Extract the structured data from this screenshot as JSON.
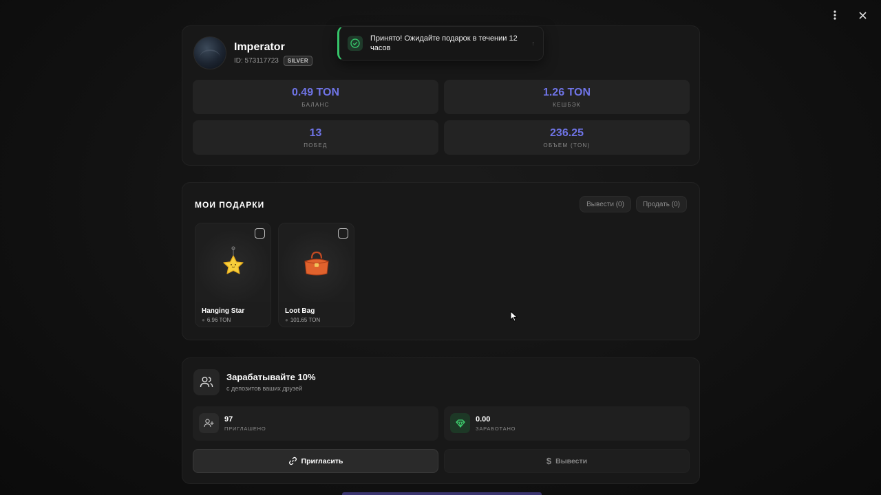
{
  "profile": {
    "username": "Imperator",
    "user_id": "ID: 573117723",
    "tier": "SILVER",
    "stats": [
      {
        "value": "0.49 TON",
        "label": "БАЛАНС"
      },
      {
        "value": "1.26 TON",
        "label": "КЕШБЭК"
      },
      {
        "value": "13",
        "label": "ПОБЕД"
      },
      {
        "value": "236.25",
        "label": "ОБЪЕМ (TON)"
      }
    ]
  },
  "toast": {
    "message": "Принято! Ожидайте подарок в течении 12 часов",
    "status_color": "#36c46a"
  },
  "gifts": {
    "title": "МОИ ПОДАРКИ",
    "withdraw_label": "Вывести (0)",
    "sell_label": "Продать (0)",
    "items": [
      {
        "name": "Hanging Star",
        "price": "6.96 TON",
        "icon": "star-icon",
        "selected": false
      },
      {
        "name": "Loot Bag",
        "price": "101.65 TON",
        "icon": "bag-icon",
        "selected": false
      }
    ]
  },
  "referral": {
    "title": "Зарабатывайте 10%",
    "subtitle": "с депозитов ваших друзей",
    "invited_count": "97",
    "invited_label": "ПРИГЛАШЕНО",
    "earned_value": "0.00",
    "earned_label": "ЗАРАБОТАНО",
    "invite_label": "Пригласить",
    "withdraw_label": "Вывести"
  },
  "colors": {
    "accent": "#6f74e6",
    "success": "#36c46a",
    "background": "#111111",
    "panel": "#181818"
  }
}
